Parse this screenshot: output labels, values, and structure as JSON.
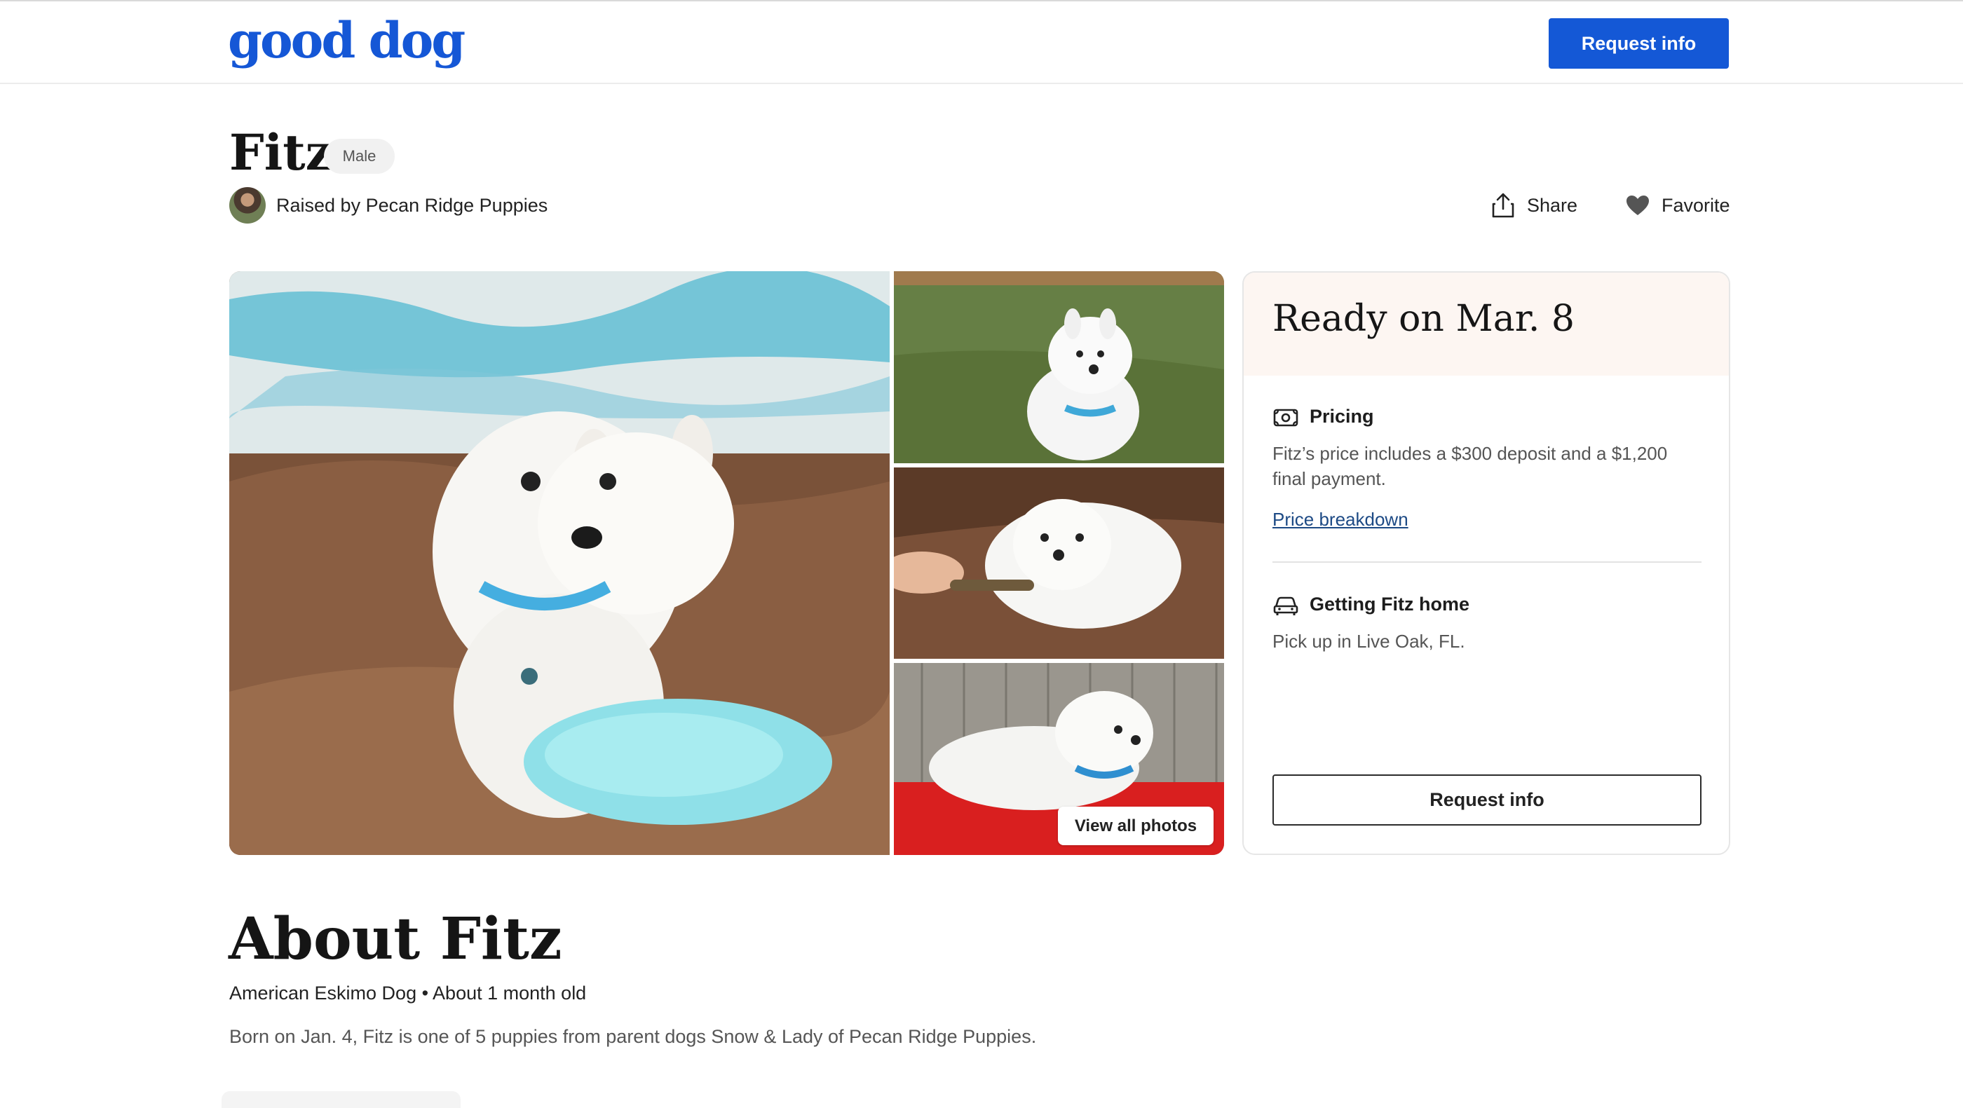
{
  "header": {
    "logo": "good dog",
    "request_button": "Request info"
  },
  "dog": {
    "name": "Fitz",
    "sex_badge": "Male",
    "raised_by": "Raised by Pecan Ridge Puppies"
  },
  "actions": {
    "share": "Share",
    "favorite": "Favorite"
  },
  "gallery": {
    "view_all": "View all photos"
  },
  "card": {
    "title": "Ready on Mar. 8",
    "pricing": {
      "title": "Pricing",
      "line1": "Fitz’s price includes a $300 deposit and a $1,200",
      "line2": "final payment.",
      "link": "Price breakdown"
    },
    "getting_home": {
      "title": "Getting Fitz home",
      "text": "Pick up in Live Oak, FL."
    },
    "request_button": "Request info"
  },
  "about": {
    "title": "About Fitz",
    "subtitle": "American Eskimo Dog • About 1 month old",
    "text": "Born on Jan. 4, Fitz is one of 5 puppies from parent dogs Snow & Lady of Pecan Ridge Puppies."
  },
  "colors": {
    "brand": "#1458d6",
    "card_header": "#fdf6f2",
    "link": "#1d4a85"
  },
  "icons": [
    "share-icon",
    "heart-icon",
    "money-icon",
    "car-icon"
  ]
}
